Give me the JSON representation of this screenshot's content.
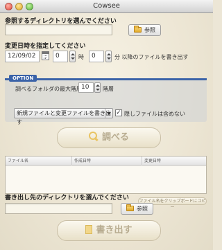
{
  "window": {
    "title": "Cowsee"
  },
  "source": {
    "label": "参照するディレクトリを選んでください",
    "path_value": "",
    "browse_label": "参照"
  },
  "modified": {
    "label": "変更日時を指定してください",
    "date_value": "12/09/02",
    "hour_value": "0",
    "hour_unit": "時",
    "minute_value": "0",
    "minute_suffix": "分 以降のファイルを書き出す"
  },
  "option": {
    "tag": "OPTION",
    "depth_label": "調べるフォルダの最大階層",
    "depth_value": "10",
    "depth_unit": "階層",
    "mode_selected": "新規ファイルと変更ファイルを書き出す",
    "exclude_hidden_label": "隠しファイルは含めない",
    "exclude_hidden_checked": true
  },
  "search_button": {
    "label": "調べる"
  },
  "results_table": {
    "columns": [
      "ファイル名",
      "作成日時",
      "変更日時"
    ],
    "rows": []
  },
  "copy_button": {
    "label": "ファイル名をクリップボードにコピー"
  },
  "destination": {
    "label": "書き出し先のディレクトリを選んでください",
    "path_value": "",
    "browse_label": "参照"
  },
  "export_button": {
    "label": "書き出す"
  }
}
